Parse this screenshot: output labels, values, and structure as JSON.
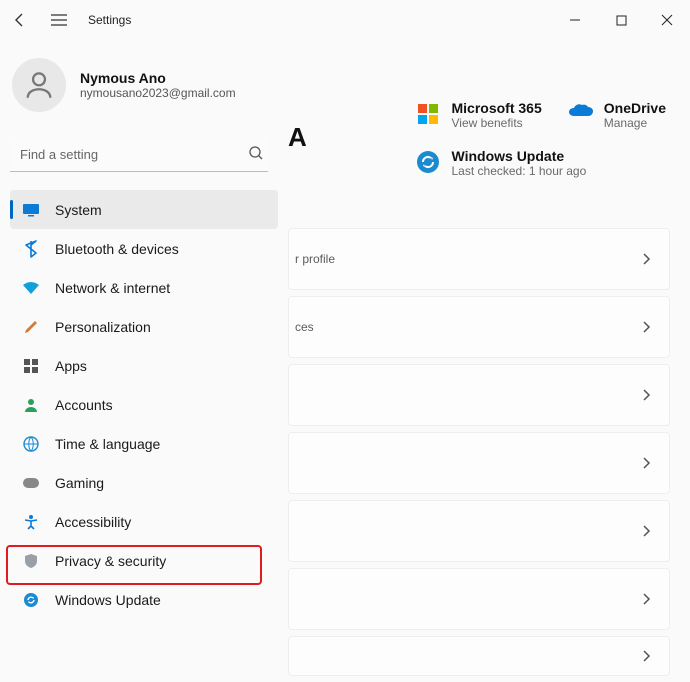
{
  "app_title": "Settings",
  "account": {
    "name": "Nymous Ano",
    "email": "nymousano2023@gmail.com"
  },
  "search": {
    "placeholder": "Find a setting"
  },
  "nav": [
    {
      "label": "System"
    },
    {
      "label": "Bluetooth & devices"
    },
    {
      "label": "Network & internet"
    },
    {
      "label": "Personalization"
    },
    {
      "label": "Apps"
    },
    {
      "label": "Accounts"
    },
    {
      "label": "Time & language"
    },
    {
      "label": "Gaming"
    },
    {
      "label": "Accessibility"
    },
    {
      "label": "Privacy & security"
    },
    {
      "label": "Windows Update"
    }
  ],
  "tiles": {
    "m365": {
      "title": "Microsoft 365",
      "sub": "View benefits"
    },
    "onedrive": {
      "title": "OneDrive",
      "sub": "Manage"
    },
    "update": {
      "title": "Windows Update",
      "sub": "Last checked: 1 hour ago"
    }
  },
  "heading_fragment": "A",
  "card_fragments": {
    "c0": "r profile",
    "c1": "ces"
  }
}
